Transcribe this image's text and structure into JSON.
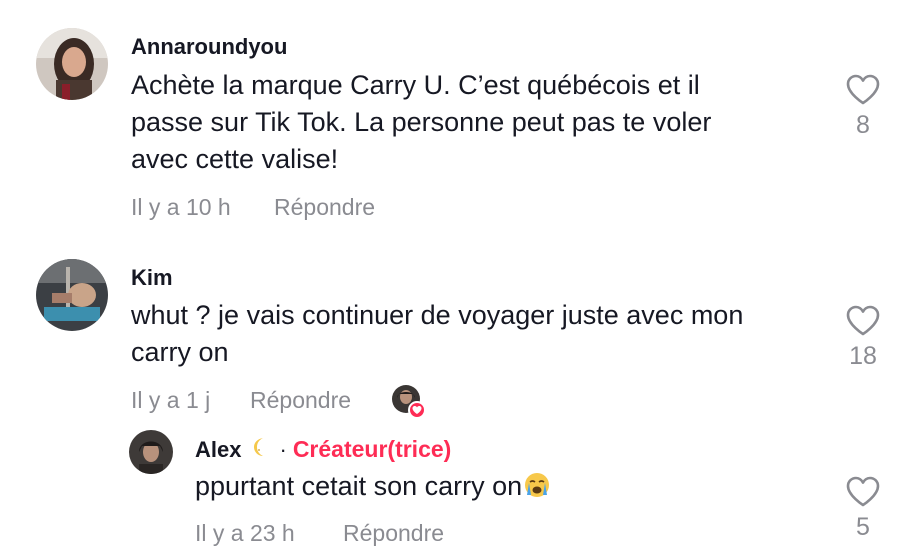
{
  "comments": [
    {
      "username": "Annaroundyou",
      "text_lines": [
        "Achète la marque Carry U. C’est québécois et il",
        "passe sur Tik Tok. La personne peut pas te voler",
        "avec cette valise!"
      ],
      "time": "Il y a 10 h",
      "reply_label": "Répondre",
      "likes": "8",
      "like_icon": "heart-outline-icon"
    },
    {
      "username": "Kim",
      "text_lines": [
        "whut ? je vais continuer de voyager juste avec mon",
        "carry on"
      ],
      "time": "Il y a 1 j",
      "reply_label": "Répondre",
      "likes": "18",
      "like_icon": "heart-outline-icon",
      "creator_liked_icon": "creator-liked-badge"
    }
  ],
  "reply": {
    "username": "Alex",
    "separator": "·",
    "creator_label": "Créateur(trice)",
    "text": "ppurtant cetait son carry on",
    "time": "Il y a 23 h",
    "reply_label": "Répondre",
    "likes": "5",
    "like_icon": "heart-outline-icon"
  },
  "colors": {
    "text": "#161823",
    "secondary": "#8a8b91",
    "creator": "#fe2c55"
  }
}
